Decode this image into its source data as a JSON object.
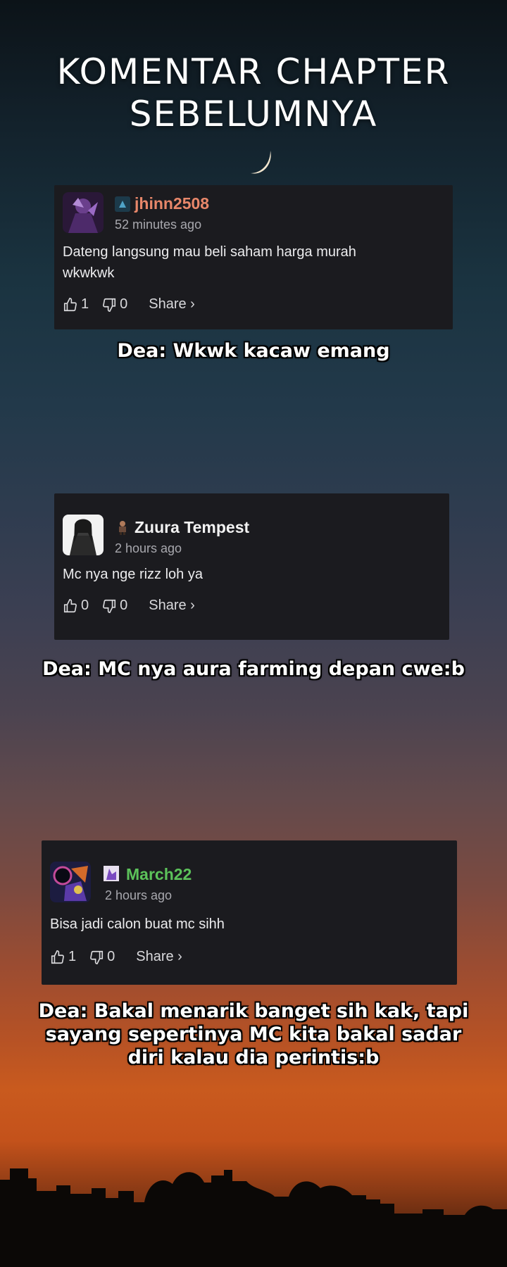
{
  "page_title": "KOMENTAR CHAPTER SEBELUMNYA",
  "title_lines": [
    "KOMENTAR CHAPTER",
    "SEBELUMNYA"
  ],
  "share_label": "Share ›",
  "comments": [
    {
      "username": "jhinn2508",
      "username_color": "#e8876a",
      "time": "52 minutes ago",
      "text_lines": [
        "Dateng langsung mau beli saham harga murah",
        "wkwkwk"
      ],
      "likes": "1",
      "dislikes": "0",
      "reply_lines": [
        "Dea: Wkwk kacaw emang"
      ]
    },
    {
      "username": "Zuura Tempest",
      "username_color": "#f2f2f2",
      "time": "2 hours ago",
      "text_lines": [
        "Mc nya nge rizz loh ya"
      ],
      "likes": "0",
      "dislikes": "0",
      "reply_lines": [
        "Dea: MC nya aura farming depan cwe:b"
      ]
    },
    {
      "username": "March22",
      "username_color": "#5cc25a",
      "time": "2 hours ago",
      "text_lines": [
        "Bisa jadi calon buat mc sihh"
      ],
      "likes": "1",
      "dislikes": "0",
      "reply_lines": [
        "Dea: Bakal menarik banget sih kak, tapi",
        "sayang sepertinya MC kita bakal sadar",
        "diri kalau dia perintis:b"
      ]
    }
  ],
  "colors": {
    "card_bg": "#1b1b1f",
    "muted_text": "#a8a8ae"
  },
  "icons": [
    "moon-icon",
    "thumbs-up-icon",
    "thumbs-down-icon",
    "chevron-right-icon",
    "user-badge-icon"
  ]
}
